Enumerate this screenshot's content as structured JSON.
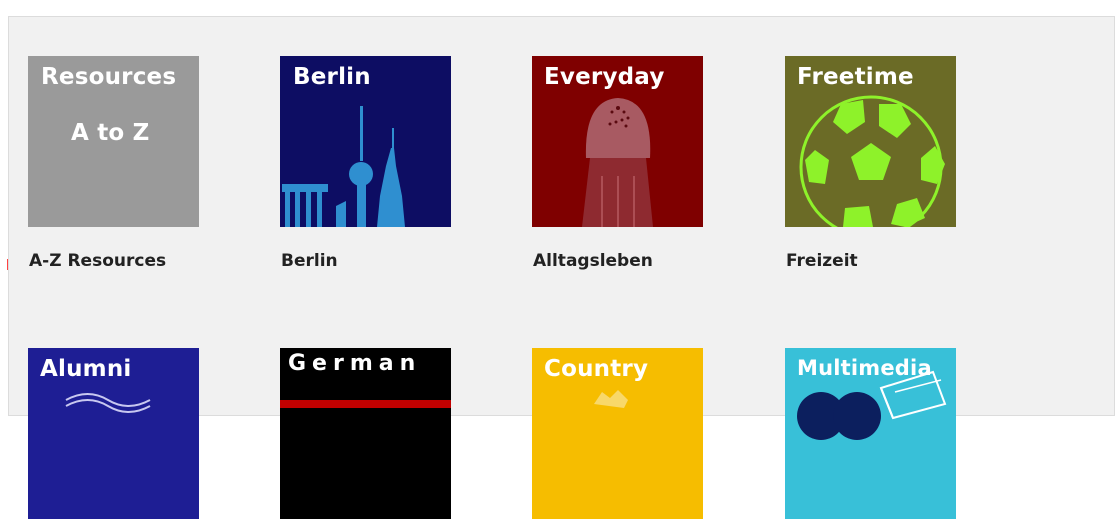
{
  "edge_text": "r,",
  "tiles": [
    {
      "title": "Resources",
      "subtitle": "A to Z",
      "caption": "A-Z Resources"
    },
    {
      "title": "Berlin",
      "caption": "Berlin"
    },
    {
      "title": "Everyday",
      "caption": "Alltagsleben"
    },
    {
      "title": "Freetime",
      "caption": "Freizeit"
    },
    {
      "title": "Alumni",
      "caption": ""
    },
    {
      "title": "German",
      "caption": ""
    },
    {
      "title": "Country",
      "caption": ""
    },
    {
      "title": "Multimedia",
      "caption": ""
    }
  ],
  "colors": {
    "resources": "#9a9a9a",
    "berlin": "#0d0d63",
    "everyday": "#7f0000",
    "freetime": "#6b6b26",
    "alumni": "#1e1e94",
    "german": "#000000",
    "country": "#f6bd00",
    "multimedia": "#38c0d8",
    "edge_text": "#ff1a1a"
  },
  "icons": [
    "tv-tower-icon",
    "salt-shaker-icon",
    "football-icon",
    "wave-icon",
    "flag-stripe-icon",
    "map-icon",
    "film-reel-icon"
  ]
}
